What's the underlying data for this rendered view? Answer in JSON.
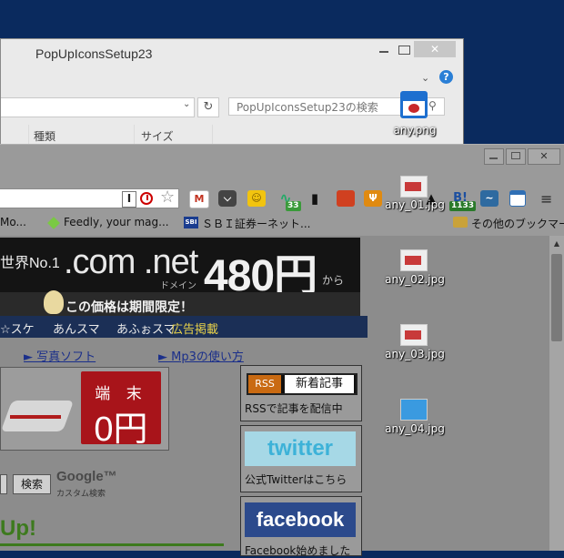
{
  "explorer": {
    "title": "PopUpIconsSetup23",
    "close": "✕",
    "help": "?",
    "search_placeholder": "PopUpIconsSetup23の検索",
    "columns": [
      "種類",
      "サイズ"
    ]
  },
  "browser": {
    "close": "✕",
    "reader_icon_text": "I",
    "extensions": {
      "gmail": "M",
      "pulse_badge": "33",
      "b_label": "B!",
      "b_badge": "1133"
    },
    "bookmarks": [
      "Mo...",
      "Feedly, your mag...",
      "ＳＢＩ証券ーネット...",
      "その他のブックマーク"
    ],
    "sbi_icon_text": "SBI"
  },
  "page": {
    "banner": {
      "rank": "世界No.1",
      "domain": ".com .net",
      "domain_sub": "ドメイン",
      "price": "480円",
      "suffix": "から",
      "tagline": "この価格は期間限定！"
    },
    "nav": [
      "☆スケ",
      "あんスマ",
      "あふぉスマ",
      "広告掲載"
    ],
    "links": [
      "► 写真ソフト",
      "► Mp3の使い方"
    ],
    "promo": {
      "line1": "端 末",
      "line2": "0円"
    },
    "search_button": "検索",
    "google_logo": "Google™",
    "google_custom": "カスタム検索",
    "up_text": "Up!",
    "rss": {
      "badge": "RSS",
      "new": "新着記事",
      "caption": "RSSで記事を配信中"
    },
    "twitter": {
      "logo": "twitter",
      "caption": "公式Twitterはこちら"
    },
    "facebook": {
      "logo": "facebook",
      "caption": "Facebook始めました"
    }
  },
  "desktop": {
    "icons": [
      "any.png",
      "any_01.jpg",
      "any_02.jpg",
      "any_03.jpg",
      "any_04.jpg"
    ]
  }
}
